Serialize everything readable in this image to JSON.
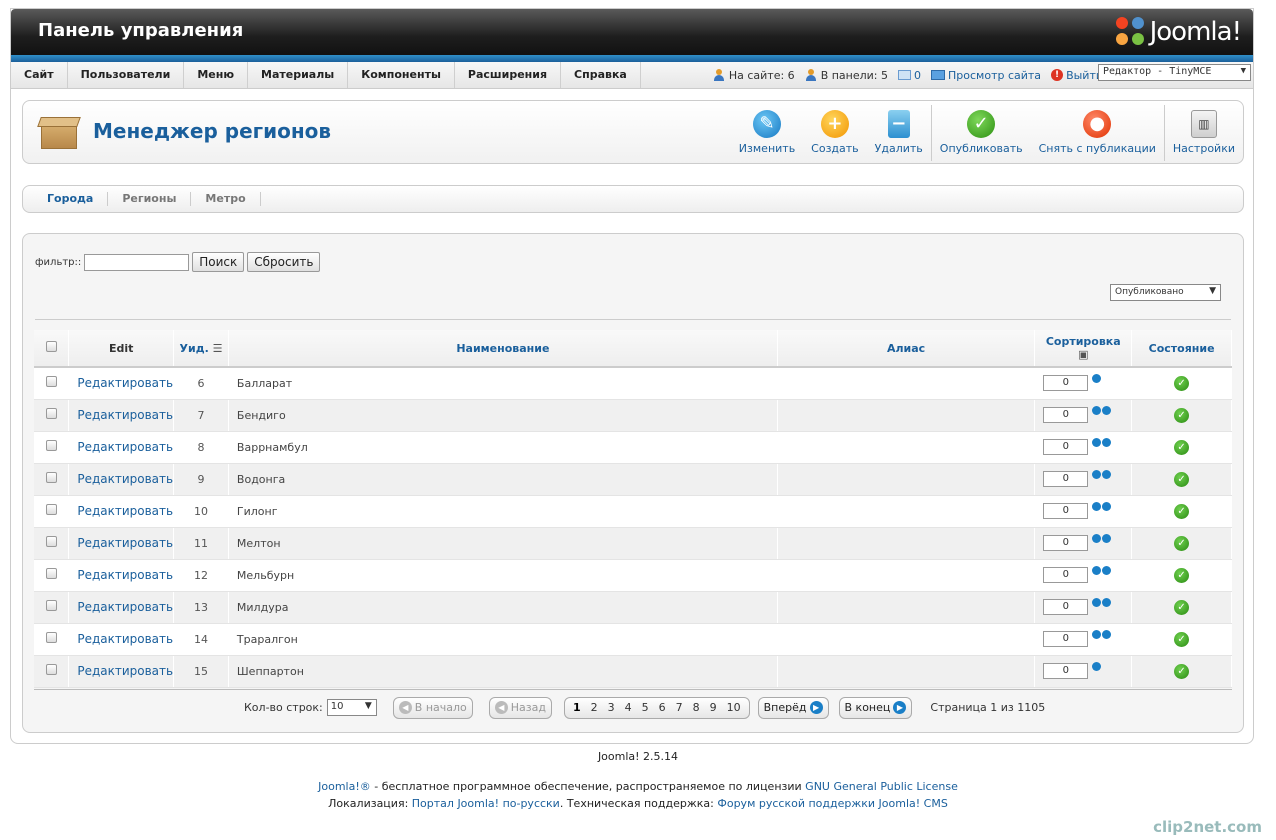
{
  "header": {
    "title": "Панель управления",
    "logo_text": "Joomla!"
  },
  "menu": [
    "Сайт",
    "Пользователи",
    "Меню",
    "Материалы",
    "Компоненты",
    "Расширения",
    "Справка"
  ],
  "status": {
    "on_site": "На сайте: 6",
    "in_panel": "В панели: 5",
    "messages": "0",
    "view_site": "Просмотр сайта",
    "logout": "Выйти",
    "editor": "Редактор - TinyMCE"
  },
  "toolbar": {
    "page_title": "Менеджер регионов",
    "edit": "Изменить",
    "new": "Создать",
    "delete": "Удалить",
    "publish": "Опубликовать",
    "unpublish": "Снять с публикации",
    "options": "Настройки"
  },
  "subnav": [
    "Города",
    "Регионы",
    "Метро"
  ],
  "filter": {
    "label": "фильтр::",
    "value": "",
    "search": "Поиск",
    "reset": "Сбросить",
    "state": "Опубликовано"
  },
  "grid": {
    "headers": {
      "edit": "Edit",
      "id": "Уид.",
      "name": "Наименование",
      "alias": "Алиас",
      "ordering": "Сортировка",
      "state": "Состояние"
    },
    "edit_label": "Редактировать",
    "rows": [
      {
        "id": "6",
        "name": "Балларат",
        "alias": "",
        "order": "0"
      },
      {
        "id": "7",
        "name": "Бендиго",
        "alias": "",
        "order": "0"
      },
      {
        "id": "8",
        "name": "Варрнамбул",
        "alias": "",
        "order": "0"
      },
      {
        "id": "9",
        "name": "Водонга",
        "alias": "",
        "order": "0"
      },
      {
        "id": "10",
        "name": "Гилонг",
        "alias": "",
        "order": "0"
      },
      {
        "id": "11",
        "name": "Мелтон",
        "alias": "",
        "order": "0"
      },
      {
        "id": "12",
        "name": "Мельбурн",
        "alias": "",
        "order": "0"
      },
      {
        "id": "13",
        "name": "Милдура",
        "alias": "",
        "order": "0"
      },
      {
        "id": "14",
        "name": "Траралгон",
        "alias": "",
        "order": "0"
      },
      {
        "id": "15",
        "name": "Шеппартон",
        "alias": "",
        "order": "0"
      }
    ]
  },
  "pagination": {
    "rows_label": "Кол-во строк:",
    "rows_value": "10",
    "start": "В начало",
    "prev": "Назад",
    "pages": [
      "1",
      "2",
      "3",
      "4",
      "5",
      "6",
      "7",
      "8",
      "9",
      "10"
    ],
    "next": "Вперёд",
    "end": "В конец",
    "info": "Страница 1 из 1105"
  },
  "footer": {
    "version": "Joomla! 2.5.14",
    "joomla_link": "Joomla!®",
    "license_text": " - бесплатное программное обеспечение, распространяемое по лицензии ",
    "license_link": "GNU General Public License",
    "loc_label": "Локализация: ",
    "loc_link": "Портал Joomla! по-русски",
    "support_label": ". Техническая поддержка: ",
    "support_link": "Форум русской поддержки Joomla! CMS"
  },
  "watermark": "clip2net.com"
}
